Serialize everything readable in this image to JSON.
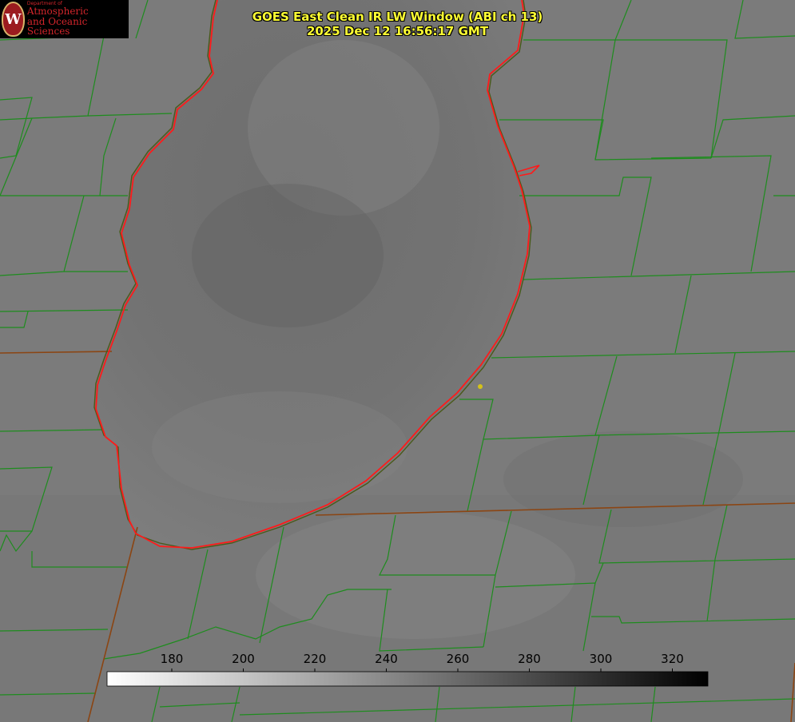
{
  "logo": {
    "dept": "Department of",
    "line1": "Atmospheric",
    "line2": "and Oceanic Sciences",
    "seal_letter": "W"
  },
  "title": {
    "line1": "GOES East Clean IR LW Window (ABI ch 13)",
    "line2": "2025 Dec 12 16:56:17 GMT"
  },
  "colorbar": {
    "ticks": [
      "180",
      "200",
      "220",
      "240",
      "260",
      "280",
      "300",
      "320"
    ],
    "from_color": "#ffffff",
    "to_color": "#000000"
  },
  "colors": {
    "county_lines": "#1e8c1e",
    "state_lines": "#8b4513",
    "lake_outline": "#ff1a1a",
    "marker": "#d4c21a",
    "title_text": "#ffff33"
  }
}
